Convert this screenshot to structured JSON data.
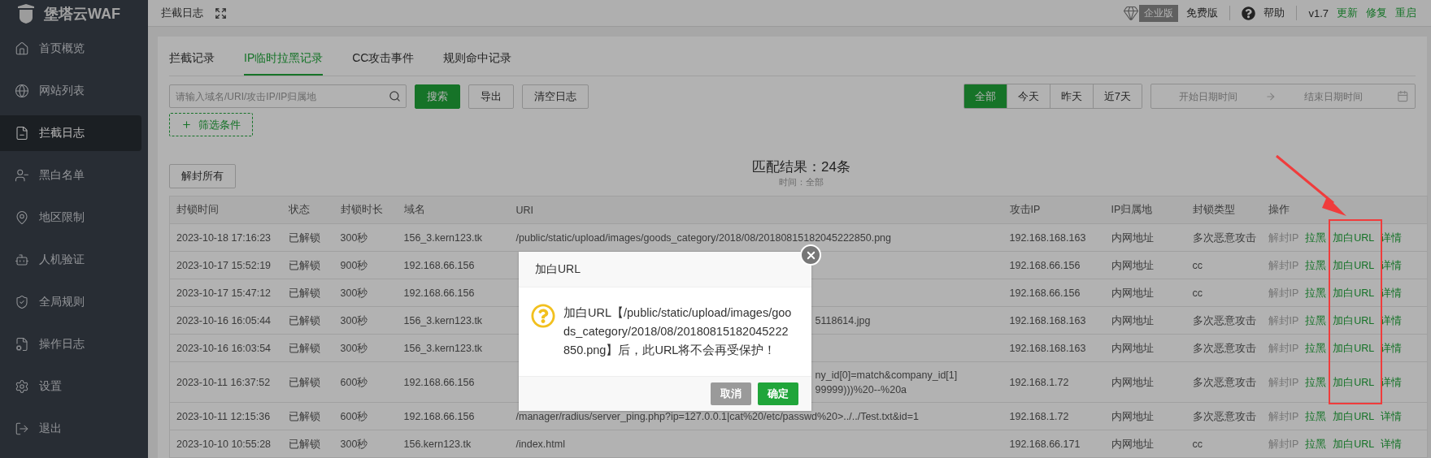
{
  "sidebar": {
    "logo": "堡塔云WAF",
    "items": [
      {
        "label": "首页概览",
        "selected": false
      },
      {
        "label": "网站列表",
        "selected": false
      },
      {
        "label": "拦截日志",
        "selected": true
      },
      {
        "label": "黑白名单",
        "selected": false
      },
      {
        "label": "地区限制",
        "selected": false
      },
      {
        "label": "人机验证",
        "selected": false
      },
      {
        "label": "全局规则",
        "selected": false
      },
      {
        "label": "操作日志",
        "selected": false
      },
      {
        "label": "设置",
        "selected": false
      },
      {
        "label": "退出",
        "selected": false
      }
    ]
  },
  "topbar": {
    "title": "拦截日志",
    "edition_badge": "企业版",
    "edition": "免费版",
    "help": "帮助",
    "version": "v1.7",
    "links": [
      "更新",
      "修复",
      "重启"
    ]
  },
  "tabs": [
    {
      "label": "拦截记录",
      "selected": false
    },
    {
      "label": "IP临时拉黑记录",
      "selected": true
    },
    {
      "label": "CC攻击事件",
      "selected": false
    },
    {
      "label": "规则命中记录",
      "selected": false
    }
  ],
  "search": {
    "placeholder": "请输入域名/URI/攻击IP/IP归属地",
    "button": "搜索"
  },
  "toolbar_buttons": [
    "导出",
    "清空日志"
  ],
  "filter_button": "筛选条件",
  "date_ranges": [
    {
      "label": "全部",
      "selected": true
    },
    {
      "label": "今天",
      "selected": false
    },
    {
      "label": "昨天",
      "selected": false
    },
    {
      "label": "近7天",
      "selected": false
    }
  ],
  "date_picker": {
    "start_placeholder": "开始日期时间",
    "end_placeholder": "结束日期时间"
  },
  "unblock_all": "解封所有",
  "result": {
    "title": "匹配结果：24条",
    "subtitle": "时间：全部"
  },
  "table": {
    "columns": [
      "封锁时间",
      "状态",
      "封锁时长",
      "域名",
      "URI",
      "攻击IP",
      "IP归属地",
      "封锁类型",
      "操作"
    ],
    "rows": [
      {
        "time": "2023-10-18 17:16:23",
        "status": "已解锁",
        "duration": "300秒",
        "domain": "156_3.kern123.tk",
        "uri": {
          "kind": "full",
          "lines": [
            "/public/static/upload/images/goods_category/2018/08/20180815182045222850.png"
          ]
        },
        "ip": "192.168.168.163",
        "location": "内网地址",
        "type": "多次恶意攻击",
        "actions": [
          {
            "label": "解封IP",
            "disabled": true
          },
          {
            "label": "拉黑",
            "disabled": false
          },
          {
            "label": "加白URL",
            "disabled": false
          },
          {
            "label": "详情",
            "disabled": false
          }
        ]
      },
      {
        "time": "2023-10-17 15:52:19",
        "status": "已解锁",
        "duration": "900秒",
        "domain": "192.168.66.156",
        "ip": "192.168.66.156",
        "location": "内网地址",
        "type": "cc",
        "actions": [
          {
            "label": "解封IP",
            "disabled": true
          },
          {
            "label": "拉黑",
            "disabled": false
          },
          {
            "label": "加白URL",
            "disabled": false
          },
          {
            "label": "详情",
            "disabled": false
          }
        ]
      },
      {
        "time": "2023-10-17 15:47:12",
        "status": "已解锁",
        "duration": "300秒",
        "domain": "192.168.66.156",
        "ip": "192.168.66.156",
        "location": "内网地址",
        "type": "cc",
        "actions": [
          {
            "label": "解封IP",
            "disabled": true
          },
          {
            "label": "拉黑",
            "disabled": false
          },
          {
            "label": "加白URL",
            "disabled": false
          },
          {
            "label": "详情",
            "disabled": false
          }
        ]
      },
      {
        "time": "2023-10-16 16:05:44",
        "status": "已解锁",
        "duration": "300秒",
        "domain": "156_3.kern123.tk",
        "uri": {
          "kind": "covered",
          "lines": [
            "5118614.jpg"
          ]
        },
        "ip": "192.168.168.163",
        "location": "内网地址",
        "type": "多次恶意攻击",
        "actions": [
          {
            "label": "解封IP",
            "disabled": true
          },
          {
            "label": "拉黑",
            "disabled": false
          },
          {
            "label": "加白URL",
            "disabled": false
          },
          {
            "label": "详情",
            "disabled": false
          }
        ]
      },
      {
        "time": "2023-10-16 16:03:54",
        "status": "已解锁",
        "duration": "300秒",
        "domain": "156_3.kern123.tk",
        "ip": "192.168.168.163",
        "location": "内网地址",
        "type": "多次恶意攻击",
        "actions": [
          {
            "label": "解封IP",
            "disabled": true
          },
          {
            "label": "拉黑",
            "disabled": false
          },
          {
            "label": "加白URL",
            "disabled": false
          },
          {
            "label": "详情",
            "disabled": false
          }
        ]
      },
      {
        "time": "2023-10-11 16:37:52",
        "status": "已解锁",
        "duration": "600秒",
        "domain": "192.168.66.156",
        "uri": {
          "kind": "covered",
          "lines": [
            "ny_id[0]=match&company_id[1]",
            "99999)))%20--%20a"
          ]
        },
        "ip": "192.168.1.72",
        "location": "内网地址",
        "type": "多次恶意攻击",
        "actions": [
          {
            "label": "解封IP",
            "disabled": true
          },
          {
            "label": "拉黑",
            "disabled": false
          },
          {
            "label": "加白URL",
            "disabled": false
          },
          {
            "label": "详情",
            "disabled": false
          }
        ]
      },
      {
        "time": "2023-10-11 12:15:36",
        "status": "已解锁",
        "duration": "600秒",
        "domain": "192.168.66.156",
        "uri": {
          "kind": "full",
          "lines": [
            "/manager/radius/server_ping.php?ip=127.0.0.1|cat%20/etc/passwd%20>../../Test.txt&id=1"
          ]
        },
        "ip": "192.168.1.72",
        "location": "内网地址",
        "type": "多次恶意攻击",
        "actions": [
          {
            "label": "解封IP",
            "disabled": true
          },
          {
            "label": "拉黑",
            "disabled": false
          },
          {
            "label": "加白URL",
            "disabled": false
          },
          {
            "label": "详情",
            "disabled": false
          }
        ]
      },
      {
        "time": "2023-10-10 10:55:28",
        "status": "已解锁",
        "duration": "300秒",
        "domain": "156.kern123.tk",
        "uri": {
          "kind": "full",
          "lines": [
            "/index.html"
          ]
        },
        "ip": "192.168.66.171",
        "location": "内网地址",
        "type": "cc",
        "actions": [
          {
            "label": "解封IP",
            "disabled": true
          },
          {
            "label": "拉黑",
            "disabled": false
          },
          {
            "label": "加白URL",
            "disabled": false
          },
          {
            "label": "详情",
            "disabled": false
          }
        ]
      }
    ]
  },
  "dialog": {
    "title": "加白URL",
    "message": "加白URL【/public/static/upload/images/goods_category/2018/08/20180815182045222850.png】后，此URL将不会再受保护！",
    "buttons": [
      {
        "label": "取消",
        "kind": "secondary"
      },
      {
        "label": "确定",
        "kind": "primary"
      }
    ]
  }
}
